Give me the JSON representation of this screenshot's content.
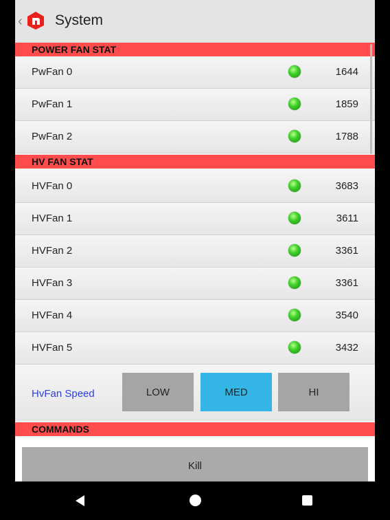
{
  "app": {
    "title": "System"
  },
  "power_section": {
    "label": "POWER FAN STAT",
    "fans": [
      {
        "name": "PwFan 0",
        "value": "1644",
        "status": "green"
      },
      {
        "name": "PwFan 1",
        "value": "1859",
        "status": "green"
      },
      {
        "name": "PwFan 2",
        "value": "1788",
        "status": "green"
      }
    ]
  },
  "hv_section": {
    "label": "HV FAN STAT",
    "fans": [
      {
        "name": "HVFan 0",
        "value": "3683",
        "status": "green"
      },
      {
        "name": "HVFan 1",
        "value": "3611",
        "status": "green"
      },
      {
        "name": "HVFan 2",
        "value": "3361",
        "status": "green"
      },
      {
        "name": "HVFan 3",
        "value": "3361",
        "status": "green"
      },
      {
        "name": "HVFan 4",
        "value": "3540",
        "status": "green"
      },
      {
        "name": "HVFan 5",
        "value": "3432",
        "status": "green"
      }
    ]
  },
  "speed": {
    "label": "HvFan Speed",
    "options": [
      "LOW",
      "MED",
      "HI"
    ],
    "selected": "MED"
  },
  "commands": {
    "label": "COMMANDS",
    "kill_label": "Kill"
  },
  "colors": {
    "section_header": "#ff4c4c",
    "selected_button": "#33b5e5",
    "speed_label": "#2b3fdc",
    "status_led": "#3fd12a"
  }
}
